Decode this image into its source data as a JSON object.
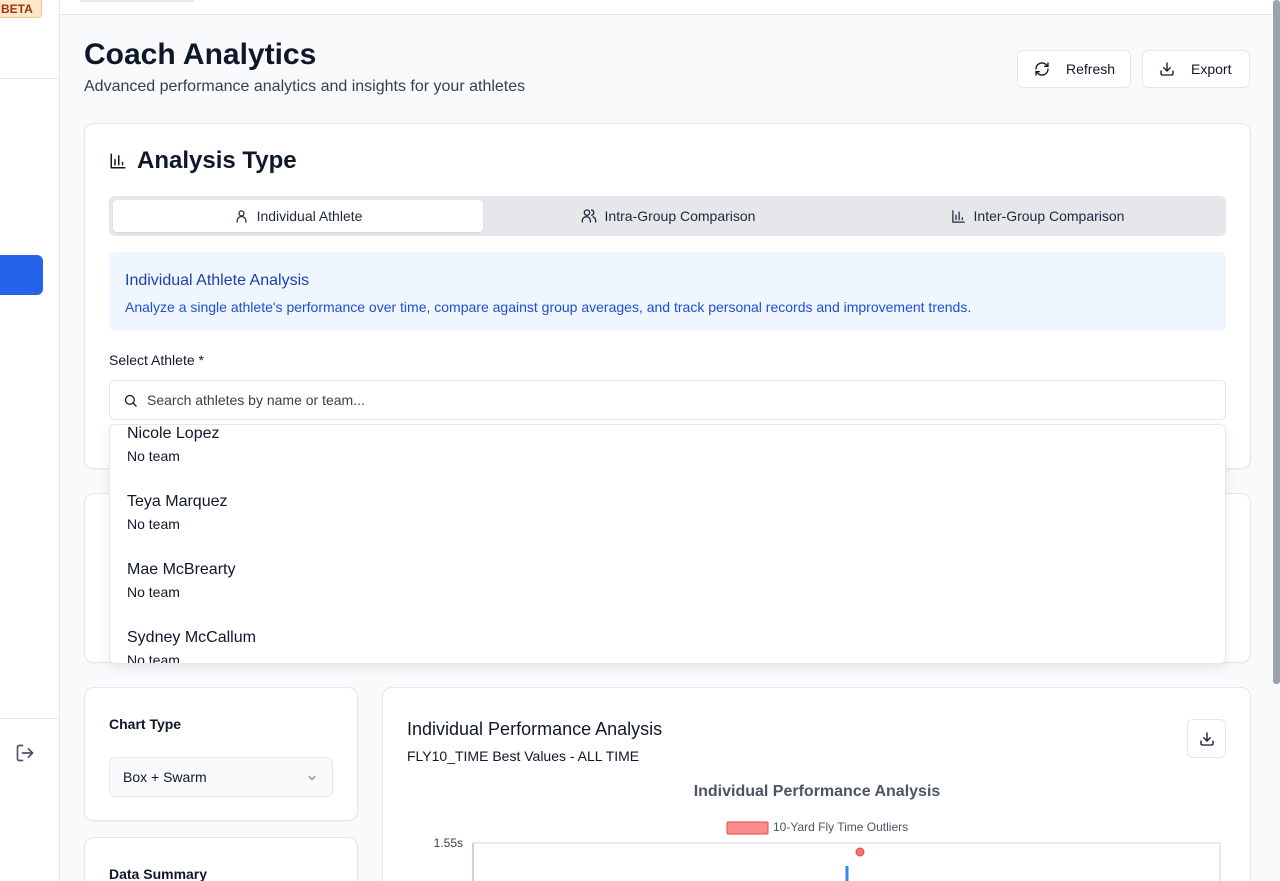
{
  "sidebar": {
    "beta_badge": "BETA"
  },
  "header": {
    "title": "Coach Analytics",
    "subtitle": "Advanced performance analytics and insights for your athletes",
    "refresh_label": "Refresh",
    "export_label": "Export"
  },
  "analysis": {
    "title": "Analysis Type",
    "tabs": [
      {
        "label": "Individual Athlete",
        "icon": "user-icon",
        "active": true
      },
      {
        "label": "Intra-Group Comparison",
        "icon": "users-icon",
        "active": false
      },
      {
        "label": "Inter-Group Comparison",
        "icon": "bar-chart-icon",
        "active": false
      }
    ],
    "info_title": "Individual Athlete Analysis",
    "info_desc": "Analyze a single athlete's performance over time, compare against group averages, and track personal records and improvement trends.",
    "select_label": "Select Athlete *",
    "search_placeholder": "Search athletes by name or team...",
    "athletes": [
      {
        "name": "Nicole Lopez",
        "team": "No team"
      },
      {
        "name": "Teya Marquez",
        "team": "No team"
      },
      {
        "name": "Mae McBrearty",
        "team": "No team"
      },
      {
        "name": "Sydney McCallum",
        "team": "No team"
      }
    ]
  },
  "chart_type": {
    "label": "Chart Type",
    "selected": "Box + Swarm"
  },
  "data_summary": {
    "label": "Data Summary"
  },
  "performance": {
    "title": "Individual Performance Analysis",
    "subtitle": "FLY10_TIME Best Values - ALL TIME"
  },
  "chart_data": {
    "type": "scatter",
    "title": "Individual Performance Analysis",
    "legend": [
      "10-Yard Fly Time Outliers"
    ],
    "legend_position": "top-center",
    "y_ticks": [
      "1.55s"
    ],
    "outlier_color": "#f87171",
    "box_color": "#3b82f6",
    "points": [
      {
        "y": 1.55,
        "series": "10-Yard Fly Time Outliers"
      }
    ]
  }
}
